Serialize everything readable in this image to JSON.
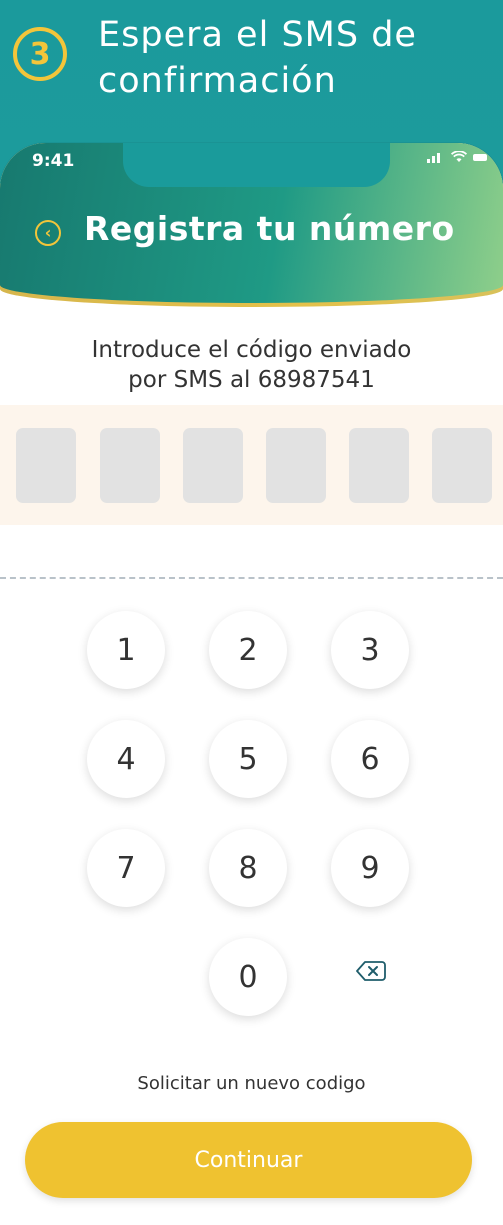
{
  "step": {
    "number": "3",
    "title_line1": "Espera el SMS de",
    "title_line2": "confirmación"
  },
  "status_bar": {
    "time": "9:41",
    "icons": [
      "signal-icon",
      "wifi-icon",
      "battery-icon"
    ]
  },
  "header": {
    "title": "Registra tu número",
    "back_icon": "chevron-left-icon"
  },
  "instruction": {
    "line1": "Introduce el código enviado",
    "line2": "por SMS al 68987541"
  },
  "code_inputs": [
    "",
    "",
    "",
    "",
    "",
    ""
  ],
  "keypad": [
    "1",
    "2",
    "3",
    "4",
    "5",
    "6",
    "7",
    "8",
    "9",
    "0"
  ],
  "resend_link": "Solicitar un nuevo codigo",
  "continue_button": "Continuar",
  "colors": {
    "accent": "#efc230",
    "teal": "#1b9a9c",
    "header_dark": "#17796f"
  }
}
